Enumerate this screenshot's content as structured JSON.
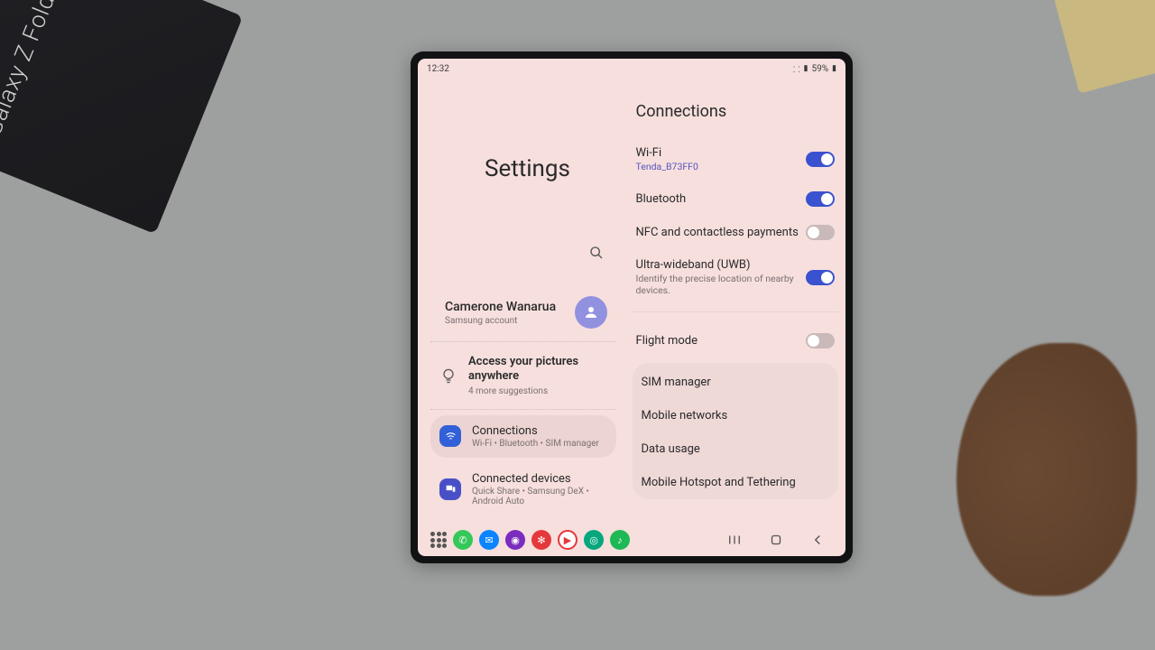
{
  "status": {
    "time": "12:32",
    "battery": "59%"
  },
  "left": {
    "title": "Settings",
    "account": {
      "name": "Camerone Wanarua",
      "sub": "Samsung account"
    },
    "suggestion": {
      "title": "Access your pictures anywhere",
      "sub": "4 more suggestions"
    },
    "items": [
      {
        "title": "Connections",
        "sub": "Wi-Fi • Bluetooth • SIM manager"
      },
      {
        "title": "Connected devices",
        "sub": "Quick Share • Samsung DeX • Android Auto"
      }
    ]
  },
  "right": {
    "title": "Connections",
    "toggles": [
      {
        "title": "Wi-Fi",
        "sub": "Tenda_B73FF0",
        "on": true,
        "link": true
      },
      {
        "title": "Bluetooth",
        "sub": "",
        "on": true
      },
      {
        "title": "NFC and contactless payments",
        "sub": "",
        "on": false
      },
      {
        "title": "Ultra-wideband (UWB)",
        "sub": "Identify the precise location of nearby devices.",
        "on": true
      }
    ],
    "flight": {
      "title": "Flight mode",
      "on": false
    },
    "rows": [
      "SIM manager",
      "Mobile networks",
      "Data usage",
      "Mobile Hotspot and Tethering"
    ]
  }
}
